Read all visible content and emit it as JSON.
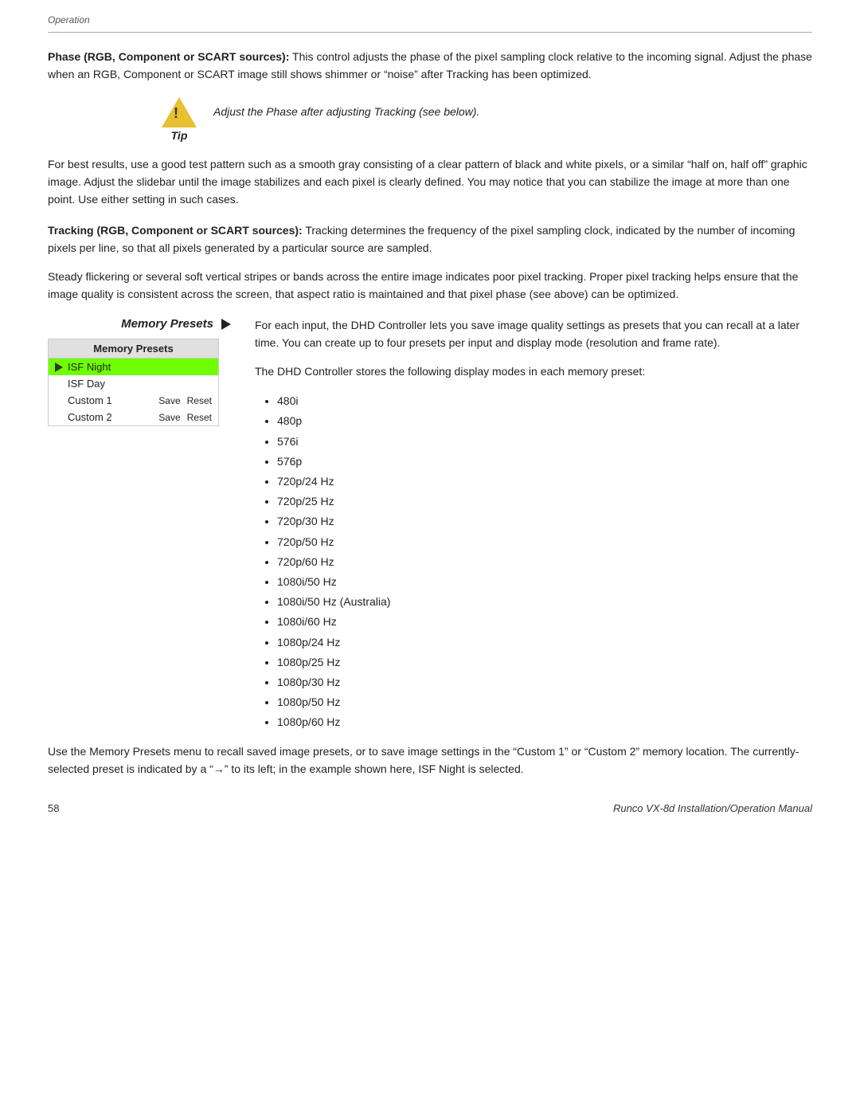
{
  "header": {
    "breadcrumb": "Operation"
  },
  "phase_section": {
    "heading": "Phase (RGB, Component or SCART sources):",
    "heading_rest": " This control adjusts the phase of the pixel sampling clock relative to the incoming signal. Adjust the phase when an RGB, Component or SCART image still shows shimmer or “noise” after Tracking has been optimized."
  },
  "tip": {
    "label": "Tip",
    "text": "Adjust the Phase after adjusting Tracking (see below)."
  },
  "phase_body": "For best results, use a good test pattern such as a smooth gray consisting of a clear pattern of black and white pixels, or a similar “half on, half off” graphic image. Adjust the slidebar until the image stabilizes and each pixel is clearly defined. You may notice that you can stabilize the image at more than one point. Use either setting in such cases.",
  "tracking_section": {
    "heading": "Tracking (RGB, Component or SCART sources):",
    "heading_rest": " Tracking determines the frequency of the pixel sampling clock, indicated by the number of incoming pixels per line, so that all pixels generated by a particular source are sampled."
  },
  "tracking_body": "Steady flickering or several soft vertical stripes or bands across the entire image indicates poor pixel tracking. Proper pixel tracking helps ensure that the image quality is consistent across the screen, that aspect ratio is maintained and that pixel phase (see above) can be optimized.",
  "memory_presets": {
    "heading": "Memory Presets",
    "arrow": "▶",
    "box_header": "Memory Presets",
    "rows": [
      {
        "name": "ISF Night",
        "active": true,
        "has_arrow": true,
        "save": null,
        "reset": null
      },
      {
        "name": "ISF Day",
        "active": false,
        "has_arrow": false,
        "save": null,
        "reset": null
      },
      {
        "name": "Custom 1",
        "active": false,
        "has_arrow": false,
        "save": "Save",
        "reset": "Reset"
      },
      {
        "name": "Custom 2",
        "active": false,
        "has_arrow": false,
        "save": "Save",
        "reset": "Reset"
      }
    ],
    "intro": "For each input, the DHD Controller lets you save image quality settings as presets that you can recall at a later time. You can create up to four presets per input and display mode (resolution and frame rate).",
    "stores_text": "The DHD Controller stores the following display modes in each memory preset:",
    "modes": [
      "480i",
      "480p",
      "576i",
      "576p",
      "720p/24 Hz",
      "720p/25 Hz",
      "720p/30 Hz",
      "720p/50 Hz",
      "720p/60 Hz",
      "1080i/50 Hz",
      "1080i/50 Hz (Australia)",
      "1080i/60 Hz",
      "1080p/24 Hz",
      "1080p/25 Hz",
      "1080p/30 Hz",
      "1080p/50 Hz",
      "1080p/60 Hz"
    ],
    "footer_text": "Use the Memory Presets menu to recall saved image presets, or to save image settings in the “Custom 1” or “Custom 2” memory location. The currently-selected preset is indicated by a “→” to its left; in the example shown here, ISF Night is selected."
  },
  "footer": {
    "page_number": "58",
    "manual_title": "Runco VX-8d Installation/Operation Manual"
  }
}
